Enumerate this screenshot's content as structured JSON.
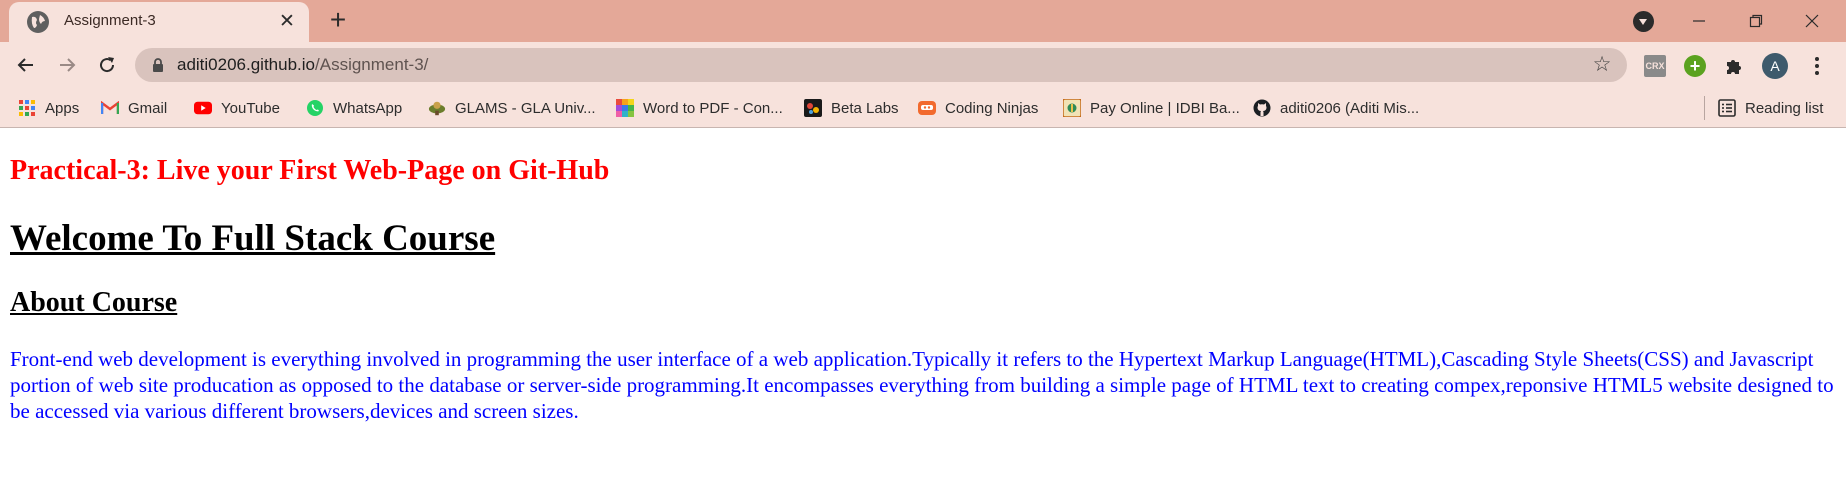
{
  "tab": {
    "title": "Assignment-3",
    "close_glyph": "✕",
    "new_tab_glyph": "+"
  },
  "omnibox": {
    "host": "aditi0206.github.io",
    "path": "/Assignment-3/"
  },
  "extensions": {
    "crx_label": "CRX",
    "plus_glyph": "+",
    "avatar_letter": "A"
  },
  "bookmarks": {
    "items": [
      {
        "label": "Apps",
        "icon": "apps-grid-icon"
      },
      {
        "label": "Gmail",
        "icon": "gmail-icon"
      },
      {
        "label": "YouTube",
        "icon": "youtube-icon"
      },
      {
        "label": "WhatsApp",
        "icon": "whatsapp-icon"
      },
      {
        "label": "GLAMS - GLA Univ...",
        "icon": "glams-icon"
      },
      {
        "label": "Word to PDF - Con...",
        "icon": "word-to-pdf-icon"
      },
      {
        "label": "Beta Labs",
        "icon": "beta-labs-icon"
      },
      {
        "label": "Coding Ninjas",
        "icon": "coding-ninjas-icon"
      },
      {
        "label": "Pay Online | IDBI Ba...",
        "icon": "idbi-icon"
      },
      {
        "label": "aditi0206 (Aditi Mis...",
        "icon": "github-icon"
      }
    ],
    "reading_list": "Reading list"
  },
  "page": {
    "title": "Practical-3: Live your First Web-Page on Git-Hub",
    "heading": "Welcome To Full Stack Course",
    "subheading": "About Course",
    "body": "Front-end web development is everything involved in programming the user interface of a web application.Typically it refers to the Hypertext Markup Language(HTML),Cascading Style Sheets(CSS) and Javascript portion of web site producation as opposed to the database or server-side programming.It encompasses everything from building a simple page of HTML text to creating compex,reponsive HTML5 website designed to be accessed via various different browsers,devices and screen sizes."
  },
  "colors": {
    "tabstrip": "#e4a898",
    "toolbar": "#f7e2dc",
    "omnibox": "#d9c3bd",
    "title_red": "#ff0000",
    "body_blue": "#0000ff"
  }
}
